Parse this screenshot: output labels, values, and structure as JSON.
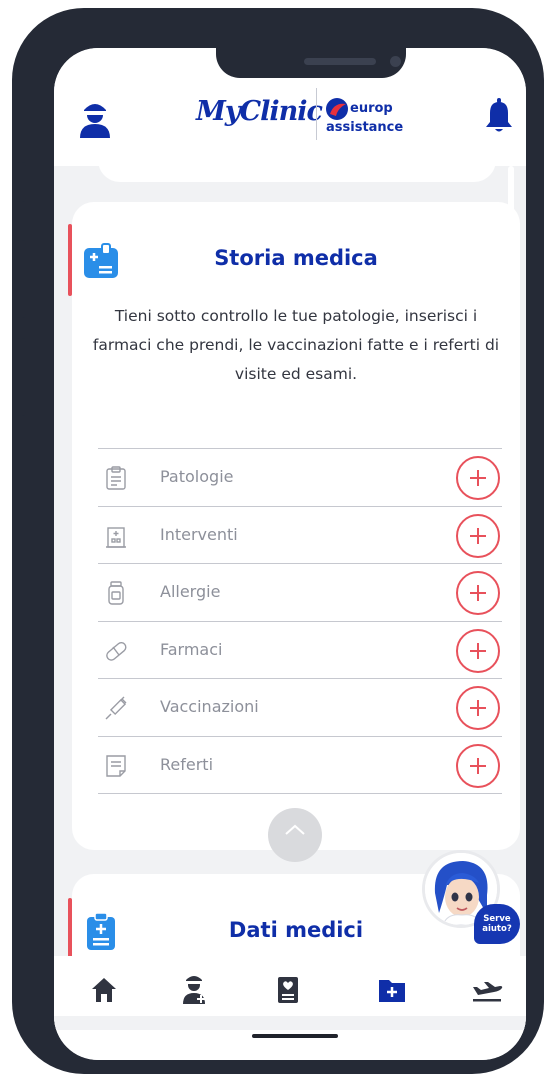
{
  "header": {
    "app_logo_text": "MyClinic",
    "partner_logo_line1": "europ",
    "partner_logo_line2": "assistance"
  },
  "card": {
    "title": "Storia medica",
    "description": "Tieni sotto controllo le tue patologie, inserisci i farmaci che prendi, le vaccinazioni fatte e i referti di visite ed esami.",
    "items": [
      {
        "label": "Patologie",
        "icon": "clipboard-icon"
      },
      {
        "label": "Interventi",
        "icon": "hospital-icon"
      },
      {
        "label": "Allergie",
        "icon": "medicine-jar-icon"
      },
      {
        "label": "Farmaci",
        "icon": "pill-icon"
      },
      {
        "label": "Vaccinazioni",
        "icon": "syringe-icon"
      },
      {
        "label": "Referti",
        "icon": "report-icon"
      }
    ]
  },
  "card2": {
    "title": "Dati medici"
  },
  "assistant": {
    "bubble_line1": "Serve",
    "bubble_line2": "aiuto?"
  },
  "tabbar": {
    "active_index": 3,
    "tabs": [
      "home-icon",
      "doctor-icon",
      "medical-record-icon",
      "medical-folder-icon",
      "flight-icon"
    ]
  },
  "colors": {
    "brand_blue": "#0f2ea8",
    "accent_red": "#e8515b",
    "text_grey": "#8d909a",
    "icon_blue": "#2a8ee8"
  }
}
